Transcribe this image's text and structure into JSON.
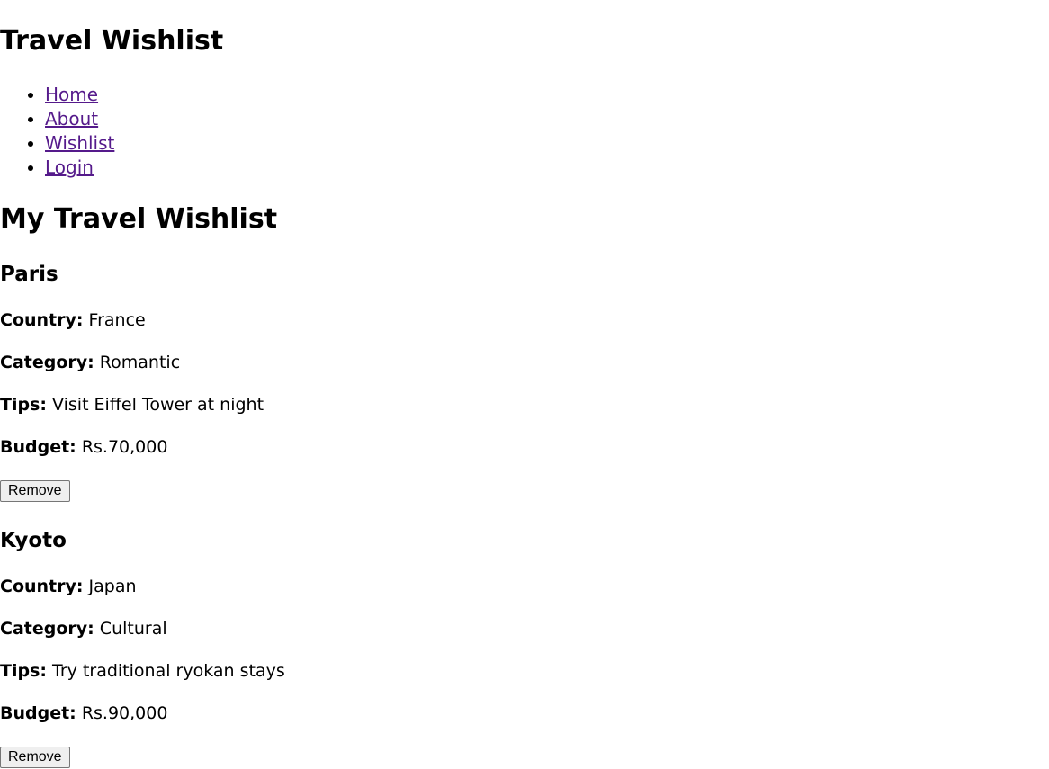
{
  "header": {
    "site_title": "Travel Wishlist"
  },
  "nav": {
    "items": [
      {
        "label": "Home"
      },
      {
        "label": "About"
      },
      {
        "label": "Wishlist"
      },
      {
        "label": "Login"
      }
    ]
  },
  "main": {
    "heading": "My Travel Wishlist",
    "labels": {
      "country": "Country:",
      "category": "Category:",
      "tips": "Tips:",
      "budget": "Budget:"
    },
    "remove_label": "Remove",
    "destinations": [
      {
        "name": "Paris",
        "country": "France",
        "category": "Romantic",
        "tips": "Visit Eiffel Tower at night",
        "budget": "Rs.70,000"
      },
      {
        "name": "Kyoto",
        "country": "Japan",
        "category": "Cultural",
        "tips": "Try traditional ryokan stays",
        "budget": "Rs.90,000"
      }
    ]
  }
}
